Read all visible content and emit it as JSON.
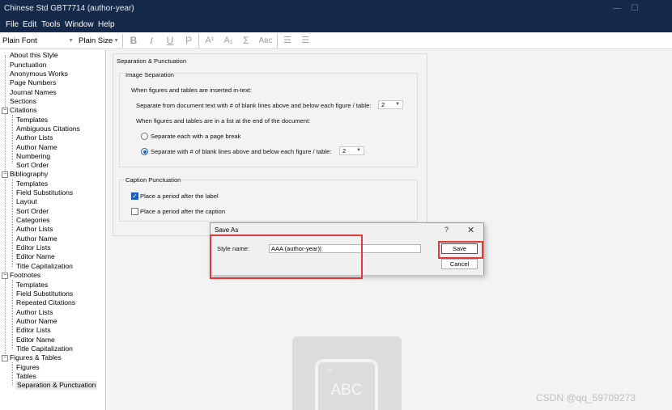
{
  "window": {
    "title": "Chinese Std GBT7714 (author-year)",
    "controls": {
      "minimize": "—",
      "maximize": "☐"
    }
  },
  "menu": [
    "File",
    "Edit",
    "Tools",
    "Window",
    "Help"
  ],
  "toolbar": {
    "font": "Plain Font",
    "size": "Plain Size",
    "icons": {
      "bold": "B",
      "italic": "I",
      "underline": "U",
      "plain": "P",
      "superscript": "A¹",
      "subscript": "A₁",
      "symbol": "Σ",
      "smallcaps": "Aʙc"
    }
  },
  "sidebar": {
    "nodes": [
      "About this Style",
      "Punctuation",
      "Anonymous Works",
      "Page Numbers",
      "Journal Names",
      "Sections",
      "Citations",
      "Templates",
      "Ambiguous Citations",
      "Author Lists",
      "Author Name",
      "Numbering",
      "Sort Order",
      "Bibliography",
      "Templates",
      "Field Substitutions",
      "Layout",
      "Sort Order",
      "Categories",
      "Author Lists",
      "Author Name",
      "Editor Lists",
      "Editor Name",
      "Title Capitalization",
      "Footnotes",
      "Templates",
      "Field Substitutions",
      "Repeated Citations",
      "Author Lists",
      "Author Name",
      "Editor Lists",
      "Editor Name",
      "Title Capitalization",
      "Figures & Tables",
      "Figures",
      "Tables",
      "Separation & Punctuation"
    ],
    "selected": "Separation & Punctuation"
  },
  "panel": {
    "title": "Separation & Punctuation",
    "image_separation": {
      "title": "Image Separation",
      "intext_heading": "When figures and tables are inserted in-text:",
      "intext_label": "Separate from document text with # of blank lines above and below each figure / table:",
      "intext_value": "2",
      "list_heading": "When figures and tables are in a list at the end of the document:",
      "radio_page_break": "Separate each with a page break",
      "radio_blank_lines": "Separate with # of blank lines above and below each figure / table:",
      "list_value": "2",
      "selected_option": "blank-lines"
    },
    "caption_punctuation": {
      "title": "Caption Punctuation",
      "period_after_label": "Place a period after the label",
      "period_after_label_checked": true,
      "period_after_caption": "Place a period after the caption",
      "period_after_caption_checked": false
    }
  },
  "dialog": {
    "title": "Save As",
    "help": "?",
    "close": "✕",
    "style_name_label": "Style name:",
    "style_name_value": "AAA (author-year)",
    "save_label": "Save",
    "cancel_label": "Cancel"
  },
  "background_badge": {
    "text": "ABC",
    "caret": "^"
  },
  "watermark": "CSDN @qq_59709273",
  "colors": {
    "titlebar": "#15294a",
    "highlight_red": "#e23838",
    "accent_blue": "#1b5fb8"
  }
}
